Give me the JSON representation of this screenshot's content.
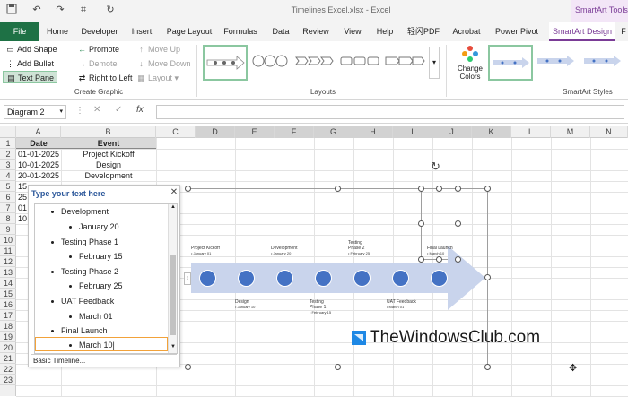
{
  "window": {
    "title": "Timelines Excel.xlsx  -  Excel",
    "contextual_tab_group": "SmartArt Tools"
  },
  "tabs": [
    "File",
    "Home",
    "Developer",
    "Insert",
    "Page Layout",
    "Formulas",
    "Data",
    "Review",
    "View",
    "Help",
    "轻闪PDF",
    "Acrobat",
    "Power Pivot",
    "SmartArt Design",
    "F"
  ],
  "active_tab": "SmartArt Design",
  "ribbon": {
    "create_graphic": {
      "add_shape": "Add Shape",
      "add_bullet": "Add Bullet",
      "text_pane": "Text Pane",
      "promote": "Promote",
      "demote": "Demote",
      "right_to_left": "Right to Left",
      "move_up": "Move Up",
      "move_down": "Move Down",
      "layout": "Layout",
      "group_label": "Create Graphic"
    },
    "layouts": {
      "group_label": "Layouts"
    },
    "styles": {
      "change_colors": "Change Colors",
      "group_label": "SmartArt Styles"
    }
  },
  "formula_bar": {
    "name_box": "Diagram 2",
    "fx": "fx",
    "value": ""
  },
  "columns": [
    "A",
    "B",
    "C",
    "D",
    "E",
    "F",
    "G",
    "H",
    "I",
    "J",
    "K",
    "L",
    "M",
    "N"
  ],
  "rows": [
    "1",
    "2",
    "3",
    "4",
    "5",
    "6",
    "7",
    "8",
    "9",
    "10",
    "11",
    "12",
    "13",
    "14",
    "15",
    "16",
    "17",
    "18",
    "19",
    "20",
    "21",
    "22",
    "23"
  ],
  "table": {
    "headers": [
      "Date",
      "Event"
    ],
    "rows": [
      [
        "01-01-2025",
        "Project Kickoff"
      ],
      [
        "10-01-2025",
        "Design"
      ],
      [
        "20-01-2025",
        "Development"
      ],
      [
        "15",
        ""
      ],
      [
        "25",
        ""
      ],
      [
        "01",
        ""
      ],
      [
        "10",
        ""
      ]
    ]
  },
  "text_pane": {
    "title": "Type your text here",
    "items": [
      {
        "level": 1,
        "text": "Development"
      },
      {
        "level": 2,
        "text": "January 20"
      },
      {
        "level": 1,
        "text": "Testing Phase 1"
      },
      {
        "level": 2,
        "text": "February 15"
      },
      {
        "level": 1,
        "text": "Testing Phase 2"
      },
      {
        "level": 2,
        "text": "February 25"
      },
      {
        "level": 1,
        "text": "UAT Feedback"
      },
      {
        "level": 2,
        "text": "March 01"
      },
      {
        "level": 1,
        "text": "Final Launch"
      },
      {
        "level": 2,
        "text": "March 10"
      }
    ],
    "footer": "Basic Timeline..."
  },
  "smartart": {
    "top_labels": [
      {
        "title": "Project Kickoff",
        "date": "January 01"
      },
      {
        "title": "Development",
        "date": "January 20"
      },
      {
        "title": "Testing Phase 2",
        "date": "February 25"
      },
      {
        "title": "Final Launch",
        "date": "March 10"
      }
    ],
    "bottom_labels": [
      {
        "title": "Design",
        "date": "January 10"
      },
      {
        "title": "Testing Phase 1",
        "date": "February 15"
      },
      {
        "title": "UAT Feedback",
        "date": "March 01"
      }
    ],
    "arrow_color": "#c9d4ec",
    "circle_color": "#4472c4"
  },
  "watermark": "TheWindowsClub.com"
}
